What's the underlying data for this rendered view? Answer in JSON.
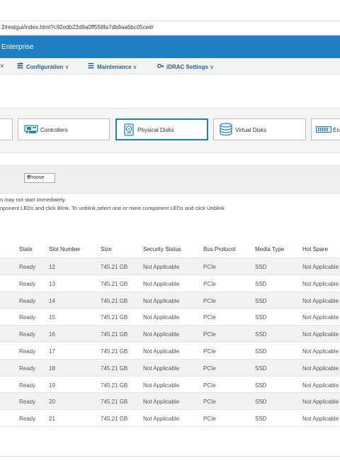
{
  "browser": {
    "url": "2/restgui/index.html?c92edb22d9a0ff558fa7db9aa6bc05ce#/"
  },
  "header": {
    "title": "Enterprise"
  },
  "menu": {
    "items": [
      {
        "label": "Configuration"
      },
      {
        "label": "Maintenance"
      },
      {
        "label": "iDRAC Settings"
      }
    ]
  },
  "tiles": [
    {
      "label": "Controllers"
    },
    {
      "label": "Physical Disks"
    },
    {
      "label": "Virtual Disks"
    },
    {
      "label": "En"
    }
  ],
  "filter": {
    "select_value": "Choose"
  },
  "info": {
    "line1": "n may not start immediately.",
    "line2": "nponent LEDs and click Blink. To unblink,select one or more component LEDs and click Unblink"
  },
  "table": {
    "columns": [
      "State",
      "Slot Number",
      "Size",
      "Security Status",
      "Bus Protocol",
      "Media Type",
      "Hot Spare"
    ],
    "rows": [
      [
        "Ready",
        "12",
        "745.21 GB",
        "Not Applicable",
        "PCIe",
        "SSD",
        "Not Applicable"
      ],
      [
        "Ready",
        "13",
        "745.21 GB",
        "Not Applicable",
        "PCIe",
        "SSD",
        "Not Applicable"
      ],
      [
        "Ready",
        "14",
        "745.21 GB",
        "Not Applicable",
        "PCIe",
        "SSD",
        "Not Applicable"
      ],
      [
        "Ready",
        "15",
        "745.21 GB",
        "Not Applicable",
        "PCIe",
        "SSD",
        "Not Applicable"
      ],
      [
        "Ready",
        "16",
        "745.21 GB",
        "Not Applicable",
        "PCIe",
        "SSD",
        "Not Applicable"
      ],
      [
        "Ready",
        "17",
        "745.21 GB",
        "Not Applicable",
        "PCIe",
        "SSD",
        "Not Applicable"
      ],
      [
        "Ready",
        "18",
        "745.21 GB",
        "Not Applicable",
        "PCIe",
        "SSD",
        "Not Applicable"
      ],
      [
        "Ready",
        "19",
        "745.21 GB",
        "Not Applicable",
        "PCIe",
        "SSD",
        "Not Applicable"
      ],
      [
        "Ready",
        "20",
        "745.21 GB",
        "Not Applicable",
        "PCIe",
        "SSD",
        "Not Applicable"
      ],
      [
        "Ready",
        "21",
        "745.21 GB",
        "Not Applicable",
        "PCIe",
        "SSD",
        "Not Applicable"
      ]
    ]
  },
  "colors": {
    "brand": "#1e7fc3",
    "menu_text": "#1e5f9c",
    "row_alt": "#f2f2f2"
  }
}
